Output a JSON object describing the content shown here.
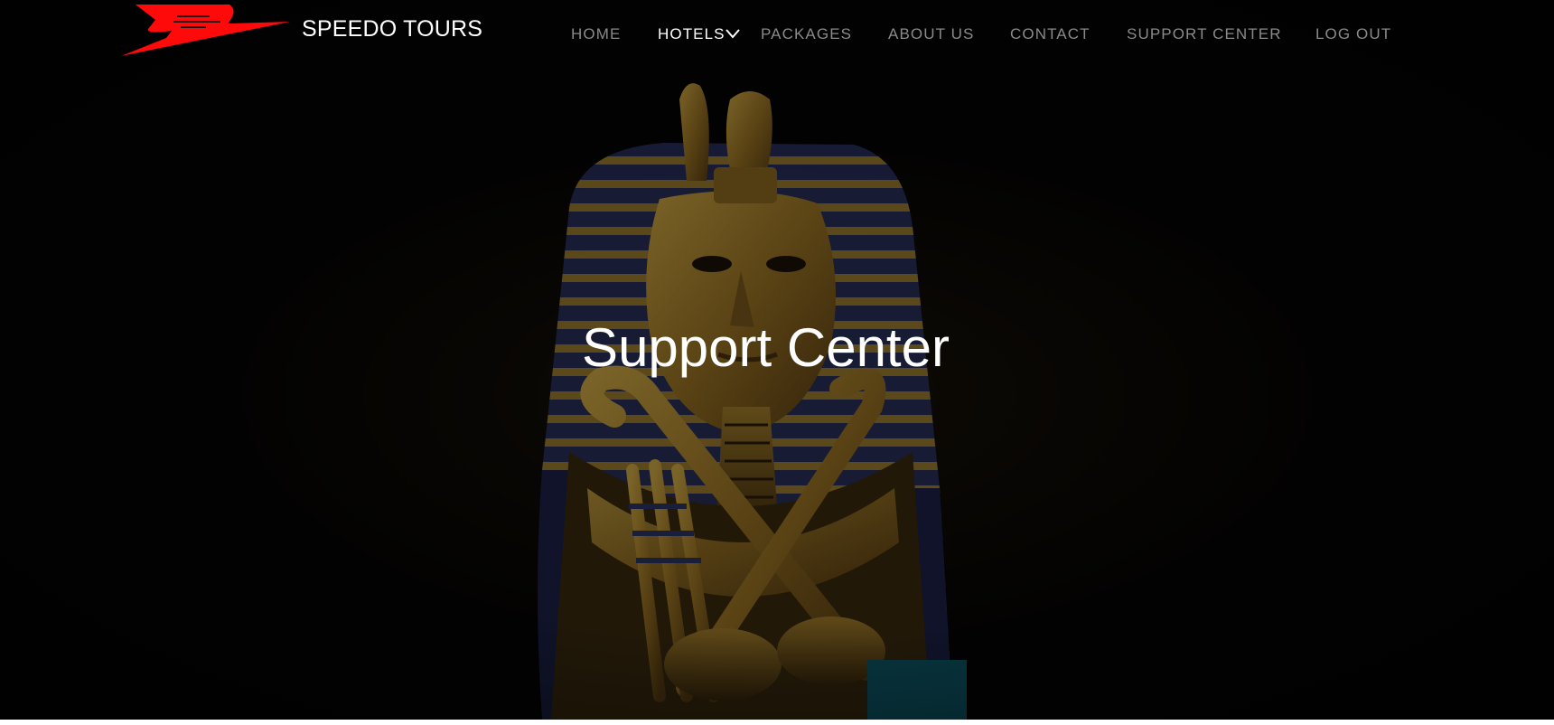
{
  "brand": {
    "name": "SPEEDO TOURS",
    "logo_icon": "red-bird-wing-logo",
    "logo_color": "#ff0a0a"
  },
  "nav": {
    "items": [
      {
        "label": "HOME",
        "active": false
      },
      {
        "label": "HOTELS",
        "active": true,
        "has_dropdown": true
      },
      {
        "label": "PACKAGES",
        "active": false
      },
      {
        "label": "ABOUT US",
        "active": false
      },
      {
        "label": "CONTACT",
        "active": false
      },
      {
        "label": "SUPPORT CENTER",
        "active": false
      },
      {
        "label": "LOG OUT",
        "active": false
      }
    ],
    "dropdown_icon": "chevron-down-icon",
    "inactive_color": "#8a8a8a",
    "active_color": "#ffffff"
  },
  "hero": {
    "title": "Support Center",
    "background_subject": "golden pharaoh statue on dark background",
    "accent_gold": "#b8902c",
    "accent_blue": "#2e3566"
  }
}
